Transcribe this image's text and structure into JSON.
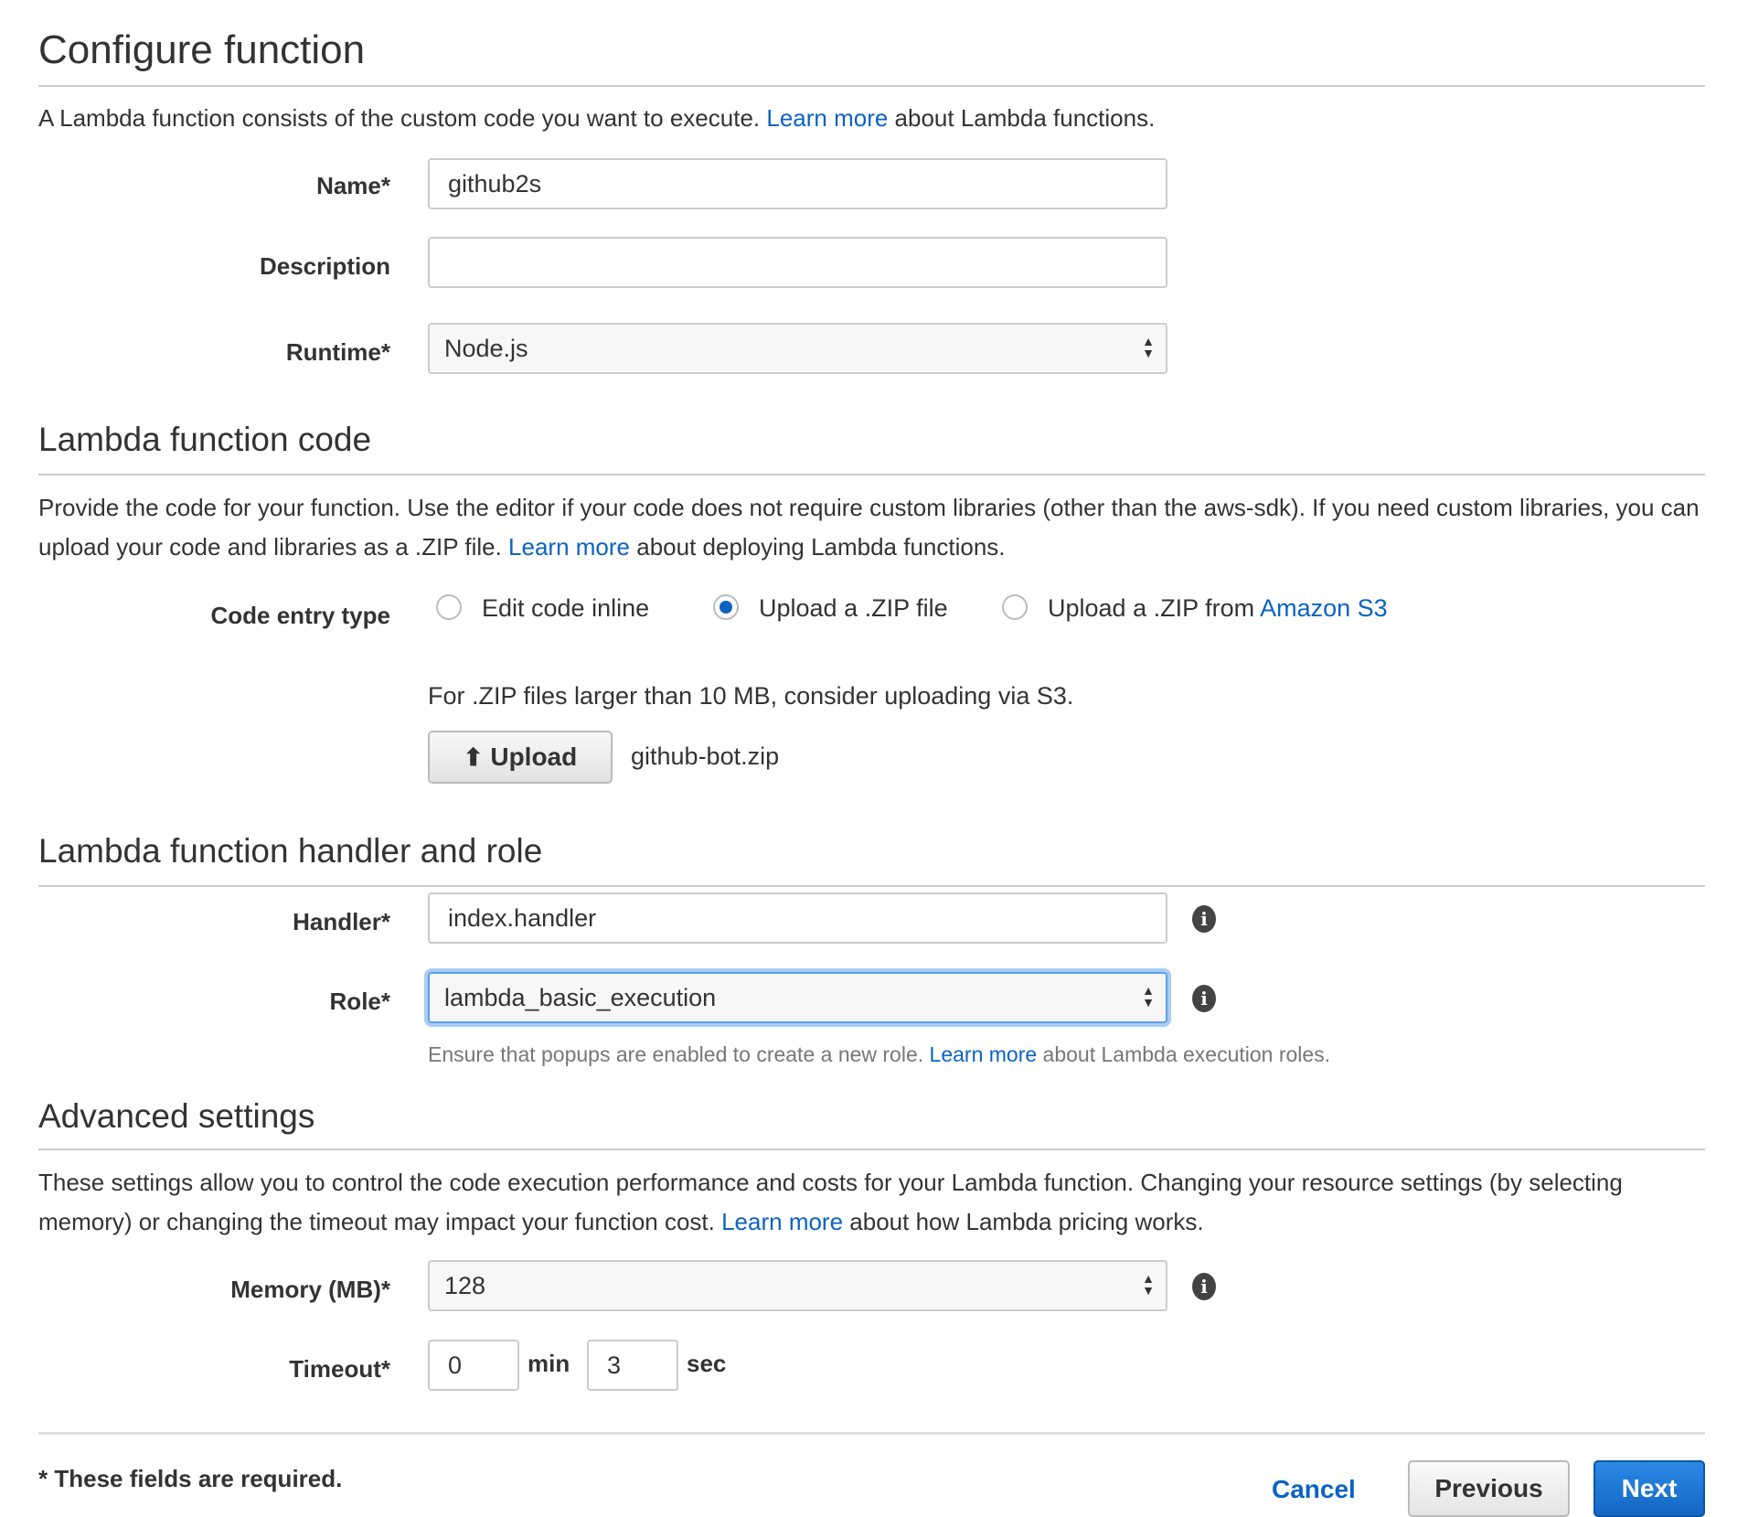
{
  "title": "Configure function",
  "intro": {
    "pre": "A Lambda function consists of the custom code you want to execute. ",
    "link": "Learn more",
    "post": " about Lambda functions."
  },
  "fields": {
    "name": {
      "label": "Name*",
      "value": "github2s"
    },
    "description": {
      "label": "Description",
      "value": ""
    },
    "runtime": {
      "label": "Runtime*",
      "value": "Node.js"
    }
  },
  "code_section": {
    "title": "Lambda function code",
    "desc_pre": "Provide the code for your function. Use the editor if your code does not require custom libraries (other than the aws-sdk). If you need custom libraries, you can upload your code and libraries as a .ZIP file. ",
    "desc_link": "Learn more",
    "desc_post": " about deploying Lambda functions.",
    "entry_label": "Code entry type",
    "options": [
      {
        "label": "Edit code inline",
        "selected": false
      },
      {
        "label": "Upload a .ZIP file",
        "selected": true
      },
      {
        "label": "Upload a .ZIP from ",
        "link": "Amazon S3",
        "selected": false
      }
    ],
    "zip_note": "For .ZIP files larger than 10 MB, consider uploading via S3.",
    "upload_label": "Upload",
    "file_name": "github-bot.zip"
  },
  "handler_section": {
    "title": "Lambda function handler and role",
    "handler": {
      "label": "Handler*",
      "value": "index.handler"
    },
    "role": {
      "label": "Role*",
      "value": "lambda_basic_execution"
    },
    "help_pre": "Ensure that popups are enabled to create a new role. ",
    "help_link": "Learn more",
    "help_post": " about Lambda execution roles."
  },
  "advanced": {
    "title": "Advanced settings",
    "desc_pre": "These settings allow you to control the code execution performance and costs for your Lambda function. Changing your resource settings (by selecting memory) or changing the timeout may impact your function cost. ",
    "desc_link": "Learn more",
    "desc_post": " about how Lambda pricing works.",
    "memory": {
      "label": "Memory (MB)*",
      "value": "128"
    },
    "timeout": {
      "label": "Timeout*",
      "min": "0",
      "min_unit": "min",
      "sec": "3",
      "sec_unit": "sec"
    }
  },
  "footer": {
    "required_note": "* These fields are required.",
    "cancel": "Cancel",
    "previous": "Previous",
    "next": "Next"
  },
  "colors": {
    "link": "#0b63c4",
    "primary": "#1a73d4"
  }
}
